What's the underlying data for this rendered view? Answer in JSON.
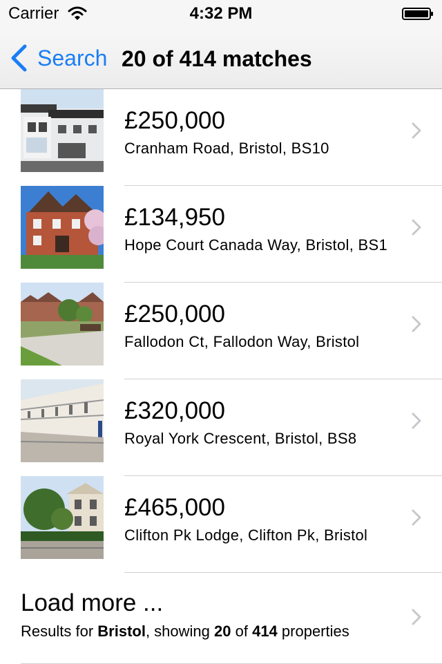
{
  "status_bar": {
    "carrier": "Carrier",
    "time": "4:32 PM"
  },
  "nav": {
    "back_label": "Search",
    "title": "20 of 414 matches"
  },
  "listings": [
    {
      "price": "£250,000",
      "address": "Cranham Road, Bristol, BS10"
    },
    {
      "price": "£134,950",
      "address": "Hope Court Canada Way, Bristol, BS1"
    },
    {
      "price": "£250,000",
      "address": "Fallodon Ct, Fallodon Way, Bristol"
    },
    {
      "price": "£320,000",
      "address": "Royal York Crescent, Bristol, BS8"
    },
    {
      "price": "£465,000",
      "address": "Clifton Pk Lodge, Clifton Pk, Bristol"
    }
  ],
  "load_more": {
    "title": "Load more ...",
    "sub_prefix": "Results for ",
    "location": "Bristol",
    "sub_mid": ", showing ",
    "shown": "20",
    "sub_of": " of ",
    "total": "414",
    "sub_suffix": " properties"
  },
  "colors": {
    "accent": "#1a7ef5",
    "chevron": "#c7c7cc"
  }
}
